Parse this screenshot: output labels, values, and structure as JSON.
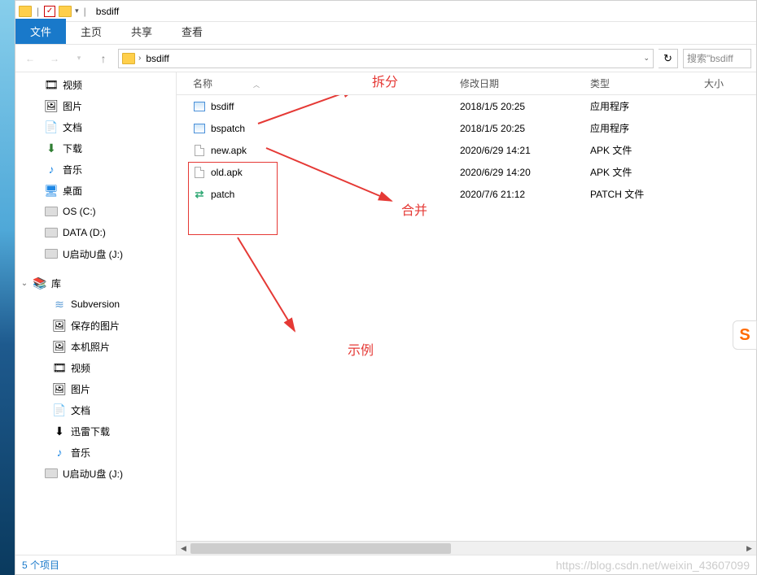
{
  "title": "bsdiff",
  "ribbon": {
    "tabs": [
      {
        "label": "文件",
        "active": true
      },
      {
        "label": "主页",
        "active": false
      },
      {
        "label": "共享",
        "active": false
      },
      {
        "label": "查看",
        "active": false
      }
    ]
  },
  "address": {
    "crumb_sep": "›",
    "path": "bsdiff"
  },
  "search": {
    "placeholder": "搜索\"bsdiff"
  },
  "tree": [
    {
      "label": "视频",
      "icon": "video",
      "level": 1
    },
    {
      "label": "图片",
      "icon": "picture",
      "level": 1
    },
    {
      "label": "文档",
      "icon": "document",
      "level": 1
    },
    {
      "label": "下载",
      "icon": "download",
      "level": 1
    },
    {
      "label": "音乐",
      "icon": "music",
      "level": 1
    },
    {
      "label": "桌面",
      "icon": "desktop",
      "level": 1
    },
    {
      "label": "OS (C:)",
      "icon": "drive-os",
      "level": 1
    },
    {
      "label": "DATA (D:)",
      "icon": "drive",
      "level": 1
    },
    {
      "label": "U启动U盘 (J:)",
      "icon": "drive-usb",
      "level": 1
    },
    {
      "label": "库",
      "icon": "library",
      "level": 0,
      "expanded": true
    },
    {
      "label": "Subversion",
      "icon": "svn",
      "level": 2
    },
    {
      "label": "保存的图片",
      "icon": "picture",
      "level": 2
    },
    {
      "label": "本机照片",
      "icon": "picture",
      "level": 2
    },
    {
      "label": "视频",
      "icon": "video",
      "level": 2
    },
    {
      "label": "图片",
      "icon": "picture",
      "level": 2
    },
    {
      "label": "文档",
      "icon": "document",
      "level": 2
    },
    {
      "label": "迅雷下载",
      "icon": "download",
      "level": 2
    },
    {
      "label": "音乐",
      "icon": "music",
      "level": 2
    },
    {
      "label": "U启动U盘 (J:)",
      "icon": "drive-usb",
      "level": 1
    }
  ],
  "columns": {
    "name": "名称",
    "date": "修改日期",
    "type": "类型",
    "size": "大小"
  },
  "files": [
    {
      "name": "bsdiff",
      "date": "2018/1/5 20:25",
      "type": "应用程序",
      "icon": "exe"
    },
    {
      "name": "bspatch",
      "date": "2018/1/5 20:25",
      "type": "应用程序",
      "icon": "exe"
    },
    {
      "name": "new.apk",
      "date": "2020/6/29 14:21",
      "type": "APK 文件",
      "icon": "file"
    },
    {
      "name": "old.apk",
      "date": "2020/6/29 14:20",
      "type": "APK 文件",
      "icon": "file"
    },
    {
      "name": "patch",
      "date": "2020/7/6 21:12",
      "type": "PATCH 文件",
      "icon": "patch"
    }
  ],
  "status": {
    "item_count_text": "5 个项目"
  },
  "annotations": {
    "split_label": "拆分",
    "merge_label": "合并",
    "example_label": "示例"
  },
  "watermark": "https://blog.csdn.net/weixin_43607099",
  "sogou_badge": "S"
}
